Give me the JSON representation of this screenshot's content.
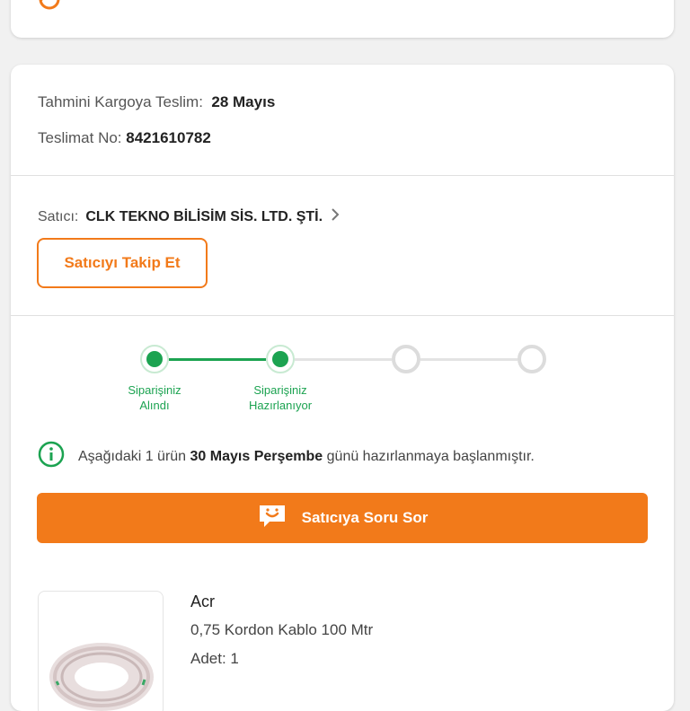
{
  "top_card": {
    "address_label": "",
    "icon": "refresh-icon"
  },
  "delivery": {
    "eta_label": "Tahmini Kargoya Teslim:",
    "eta_value": "28 Mayıs",
    "number_label": "Teslimat No:",
    "number_value": "8421610782"
  },
  "seller": {
    "label": "Satıcı:",
    "name": "CLK TEKNO BİLİSİM SİS. LTD. ŞTİ.",
    "follow_label": "Satıcıyı Takip Et"
  },
  "tracker": {
    "steps": [
      {
        "label_line1": "Siparişiniz",
        "label_line2": "Alındı",
        "done": true
      },
      {
        "label_line1": "Siparişiniz",
        "label_line2": "Hazırlanıyor",
        "done": true
      },
      {
        "label_line1": "",
        "label_line2": "",
        "done": false
      },
      {
        "label_line1": "",
        "label_line2": "",
        "done": false
      }
    ]
  },
  "note": {
    "before": "Aşağıdaki 1 ürün",
    "date": "30 Mayıs Perşembe",
    "after": "günü hazırlanmaya başlanmıştır."
  },
  "ask_button": {
    "label": "Satıcıya Soru Sor",
    "icon": "chat-smile-icon"
  },
  "product": {
    "brand": "Acr",
    "name": "0,75 Kordon Kablo 100 Mtr",
    "quantity": "Adet: 1",
    "price": ""
  },
  "colors": {
    "accent": "#f27a1a",
    "success": "#1ca351",
    "inactive": "#dcdcdc"
  }
}
